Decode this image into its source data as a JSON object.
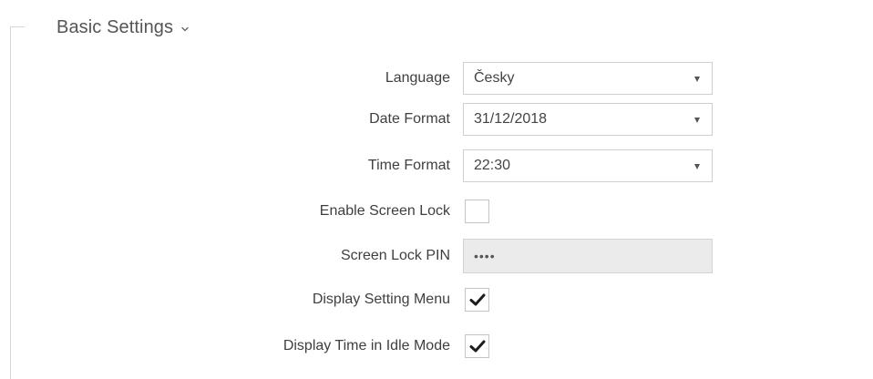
{
  "section": {
    "title": "Basic Settings",
    "expand_icon": "chevron-down-icon"
  },
  "fields": {
    "language": {
      "label": "Language",
      "value": "Česky"
    },
    "date_format": {
      "label": "Date Format",
      "value": "31/12/2018"
    },
    "time_format": {
      "label": "Time Format",
      "value": "22:30"
    },
    "enable_screen_lock": {
      "label": "Enable Screen Lock",
      "checked": false
    },
    "screen_lock_pin": {
      "label": "Screen Lock PIN",
      "value": "••••",
      "disabled": true
    },
    "display_setting_menu": {
      "label": "Display Setting Menu",
      "checked": true
    },
    "display_time_idle": {
      "label": "Display Time in Idle Mode",
      "checked": true
    }
  },
  "colors": {
    "text": "#444444",
    "border": "#cfcfcf",
    "disabled_background": "#ebebeb",
    "frame_line": "#d6d6d6"
  }
}
